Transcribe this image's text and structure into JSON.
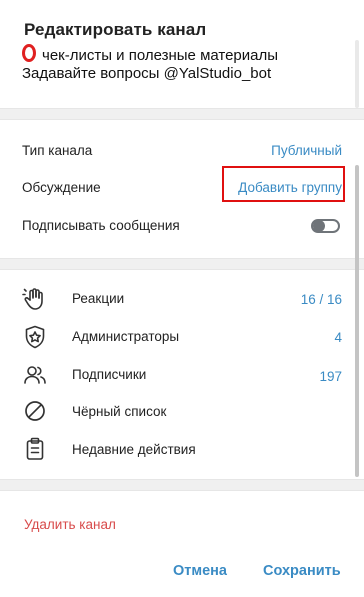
{
  "dialog": {
    "title": "Редактировать канал",
    "description": {
      "line1": "чек-листы и полезные материалы",
      "line2": "Задавайте вопросы @YalStudio_bot"
    },
    "settings": {
      "channel_type_label": "Тип канала",
      "channel_type_value": "Публичный",
      "discussion_label": "Обсуждение",
      "discussion_value": "Добавить группу",
      "sign_messages_label": "Подписывать сообщения",
      "sign_messages_enabled": false
    },
    "menu": [
      {
        "label": "Реакции",
        "count": "16 / 16",
        "icon": "reactions-hand-icon"
      },
      {
        "label": "Администраторы",
        "count": "4",
        "icon": "admin-shield-star-icon"
      },
      {
        "label": "Подписчики",
        "count": "197",
        "icon": "subscribers-people-icon"
      },
      {
        "label": "Чёрный список",
        "count": "",
        "icon": "blacklist-block-icon"
      },
      {
        "label": "Недавние действия",
        "count": "",
        "icon": "recent-actions-clipboard-icon"
      }
    ],
    "delete_label": "Удалить канал",
    "cancel_label": "Отмена",
    "save_label": "Сохранить"
  },
  "colors": {
    "accent": "#3a8bc4",
    "danger": "#d84b4b",
    "highlight_border": "#e01010",
    "separator": "#f0f0f0"
  }
}
